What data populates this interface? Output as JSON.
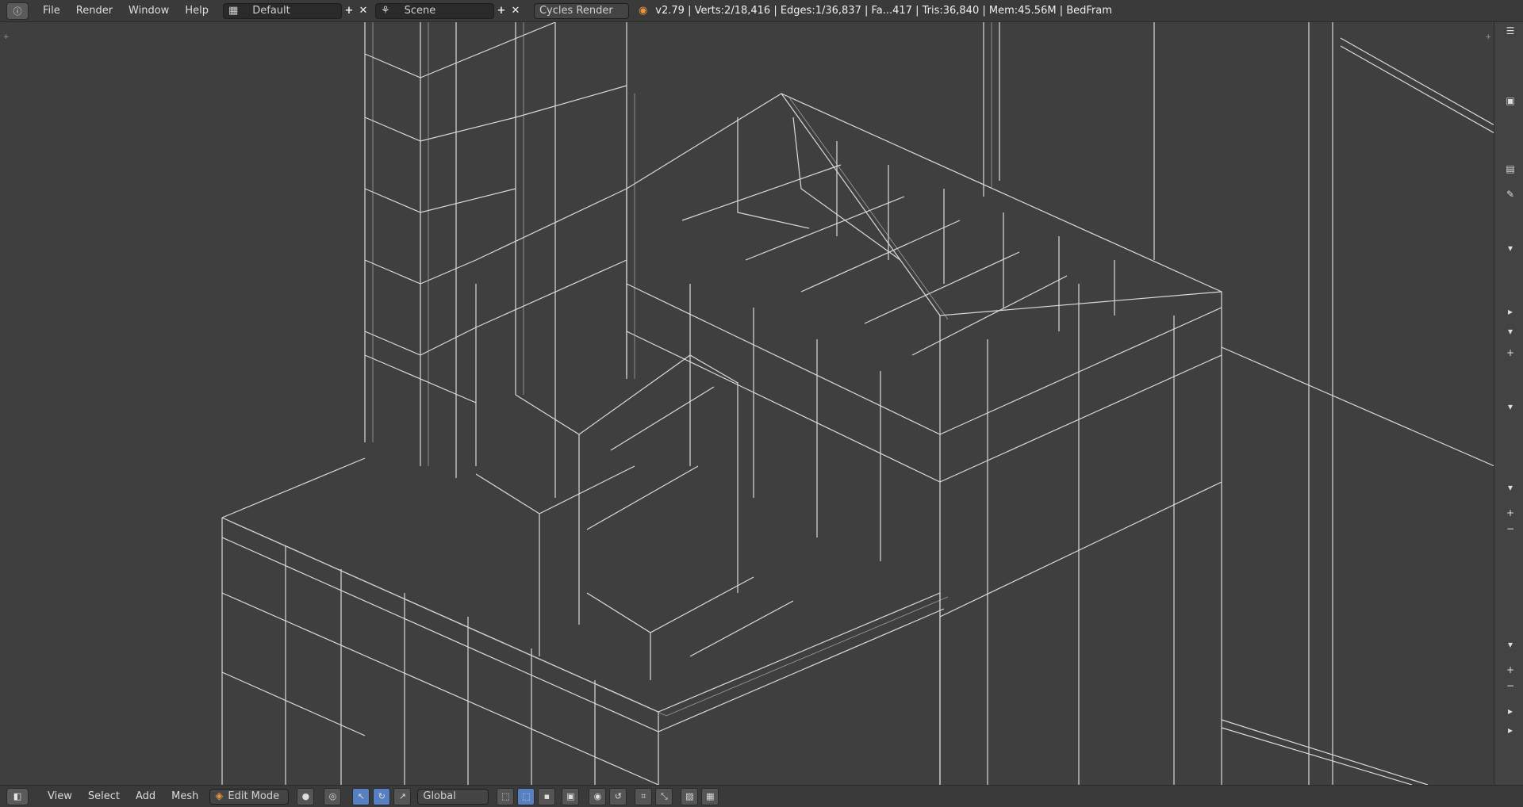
{
  "topbar": {
    "menus": [
      "File",
      "Render",
      "Window",
      "Help"
    ],
    "screen_layout": "Default",
    "scene": "Scene",
    "render_engine": "Cycles Render",
    "stats": "v2.79 | Verts:2/18,416 | Edges:1/36,837 | Fa...417 | Tris:36,840 | Mem:45.56M | BedFram"
  },
  "bottombar": {
    "menus": [
      "View",
      "Select",
      "Add",
      "Mesh"
    ],
    "mode": "Edit Mode",
    "orientation": "Global"
  },
  "colors": {
    "accent": "#5680c2",
    "wire": "#d9d9d9",
    "viewport_bg": "#3f3f3f"
  }
}
